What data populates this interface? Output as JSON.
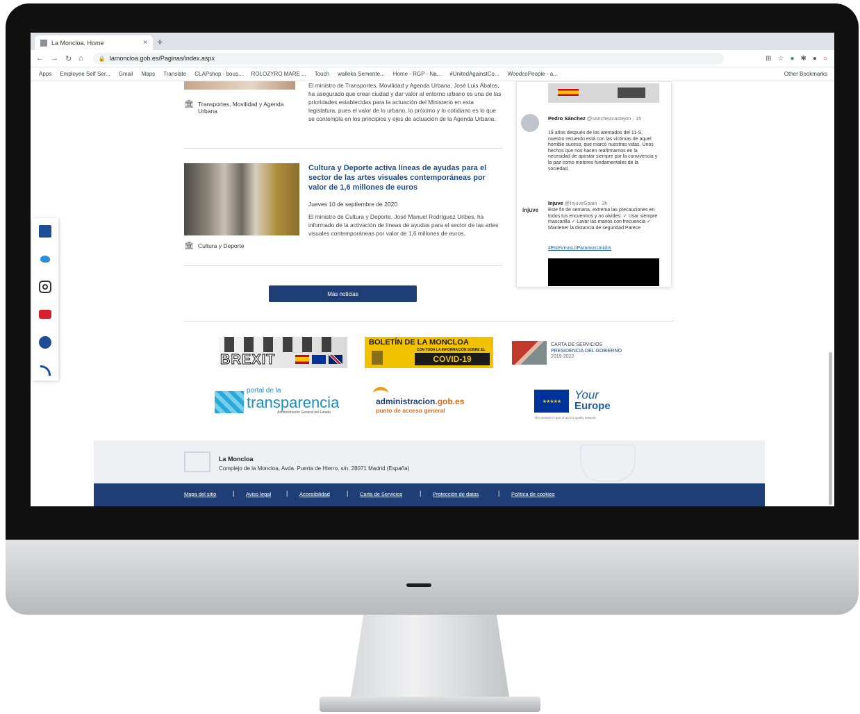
{
  "browser": {
    "tab_title": "La Moncloa. Home",
    "tab_close": "×",
    "new_tab": "+",
    "url": "lamoncloa.gob.es/Paginas/index.aspx",
    "bookmarks": [
      "Apps",
      "Employee Self Ser...",
      "Gmail",
      "Maps",
      "Translate",
      "CLAPshop - bous...",
      "ROLOZYRO MARE ...",
      "Touch",
      "walleka Semente...",
      "Home - RGP - Na...",
      "#UnitedAgainstCo...",
      "WoodcoPeople - a..."
    ],
    "other_bookmarks": "Other Bookmarks"
  },
  "articles": [
    {
      "text": "El ministro de Transportes, Movilidad y Agenda Urbana, José Luis Ábalos, ha asegurado que crear ciudad y dar valor al entorno urbano es una de las prioridades establecidas para la actuación del Ministerio en esta legislatura, pues el valor de lo urbano, lo próximo y lo cotidiano es lo que se contempla en los principios y ejes de actuación de la Agenda Urbana.",
      "category": "Transportes, Movilidad y Agenda Urbana"
    },
    {
      "title": "Cultura y Deporte activa líneas de ayudas para el sector de las artes visuales contemporáneas por valor de 1,6 millones de euros",
      "date": "Jueves 10 de septiembre de 2020",
      "text": "El ministro de Cultura y Deporte, José Manuel Rodríguez Uribes, ha informado de la activación de líneas de ayudas para el sector de las artes visuales contemporáneas por valor de 1,6 millones de euros.",
      "category": "Cultura y Deporte"
    }
  ],
  "more_news_label": "Más noticias",
  "twitter": {
    "tweet1": {
      "name": "Pedro Sánchez",
      "handle": "@sanchezcastejon · 1h",
      "text": "19 años después de los atentados del 11-S, nuestro recuerdo está con las víctimas de aquel horrible suceso, que marcó nuestras vidas. Unos hechos que nos hacen reafirmarnos en la necesidad de apostar siempre por la convivencia y la paz como motores fundamentales de la sociedad."
    },
    "tweet2": {
      "logo": "injuve",
      "name": "Injuve",
      "handle": "@InjuveSpain · 3h",
      "text": "Este fin de semana, extrema las precauciones en todos tus encuentros y no olvides: ✓ Usar siempre mascarilla ✓ Lavar las manos con frecuencia ✓ Mantener la distancia de seguridad Parece",
      "link": "#EsteVirusLoParamosUnidos"
    }
  },
  "partners": {
    "brexit": "BREXIT",
    "boletin_title": "BOLETÍN DE LA MONCLOA",
    "boletin_sub": "CON TODA LA INFORMACIÓN SOBRE EL",
    "boletin_covid": "COVID-19",
    "carta_line1": "CARTA DE SERVICIOS",
    "carta_line2": "PRESIDENCIA DEL GOBIERNO",
    "carta_years": "2019-2022",
    "transparencia_top": "portal de la",
    "transparencia_main": "transparencia",
    "transparencia_sub": "Administración General del Estado",
    "admin_main": "administracion",
    "admin_domain": ".gob.es",
    "admin_sub": "punto de acceso general",
    "eu_your": "Your",
    "eu_europe": "Europe",
    "eu_note": "This website is part of an EU quality network"
  },
  "footer": {
    "name": "La Moncloa",
    "address": "Complejo de la Moncloa, Avda. Puerta de Hierro, s/n. 28071 Madrid (España)",
    "links": [
      "Mapa del sitio",
      "Aviso legal",
      "Accesibilidad",
      "Carta de Servicios",
      "Protección de datos",
      "Política de cookies"
    ]
  },
  "social": [
    "facebook-icon",
    "twitter-icon",
    "instagram-icon",
    "youtube-icon",
    "flickr-icon",
    "rss-icon"
  ],
  "colors": {
    "nav_blue": "#1f3e75",
    "headline_blue": "#1e4d8c",
    "footer_bg": "#eef0f3"
  }
}
